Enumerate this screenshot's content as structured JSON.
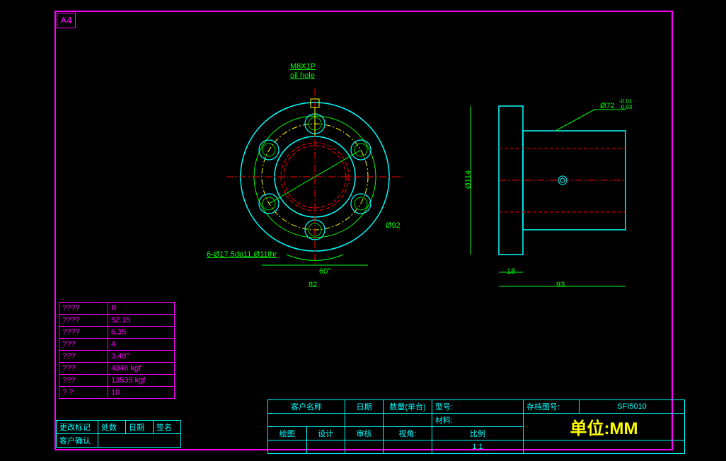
{
  "sheet": "A4",
  "annotations": {
    "thread": "M8X1P",
    "oil": "oil hole",
    "holes": "6-Ø17.5dp11,Ø11thr",
    "bcd": "Ø92",
    "angle": "60°",
    "pcd": "82",
    "od": "Ø114",
    "shaft": "Ø72",
    "tol": "-0.01\n-0.03",
    "flange": "18",
    "length": "93"
  },
  "spec": {
    "r1k": "????",
    "r1v": "R",
    "r2k": "????",
    "r2v": "52.15",
    "r3k": "????",
    "r3v": "6.35",
    "r4k": "???",
    "r4v": "4",
    "r5k": "???",
    "r5v": "3.49°",
    "r6k": "???",
    "r6v": "4346 kgf",
    "r7k": "???",
    "r7v": "13535 kgf",
    "r8k": "?  ?",
    "r8v": "10"
  },
  "rev": {
    "c1": "更改标记",
    "c2": "处数",
    "c3": "日期",
    "c4": "签名",
    "conf": "客户确认"
  },
  "title": {
    "cust": "客户名称",
    "date": "日期",
    "qty": "数量(单台)",
    "model": "型号:",
    "dwgno": "存档图号:",
    "dwgval": "SFI5010",
    "mat": "材料:",
    "draw": "绘图",
    "design": "设计",
    "check": "审核",
    "view": "视角:",
    "scale": "比例",
    "scaleval": "1:1",
    "unit": "单位:MM"
  }
}
